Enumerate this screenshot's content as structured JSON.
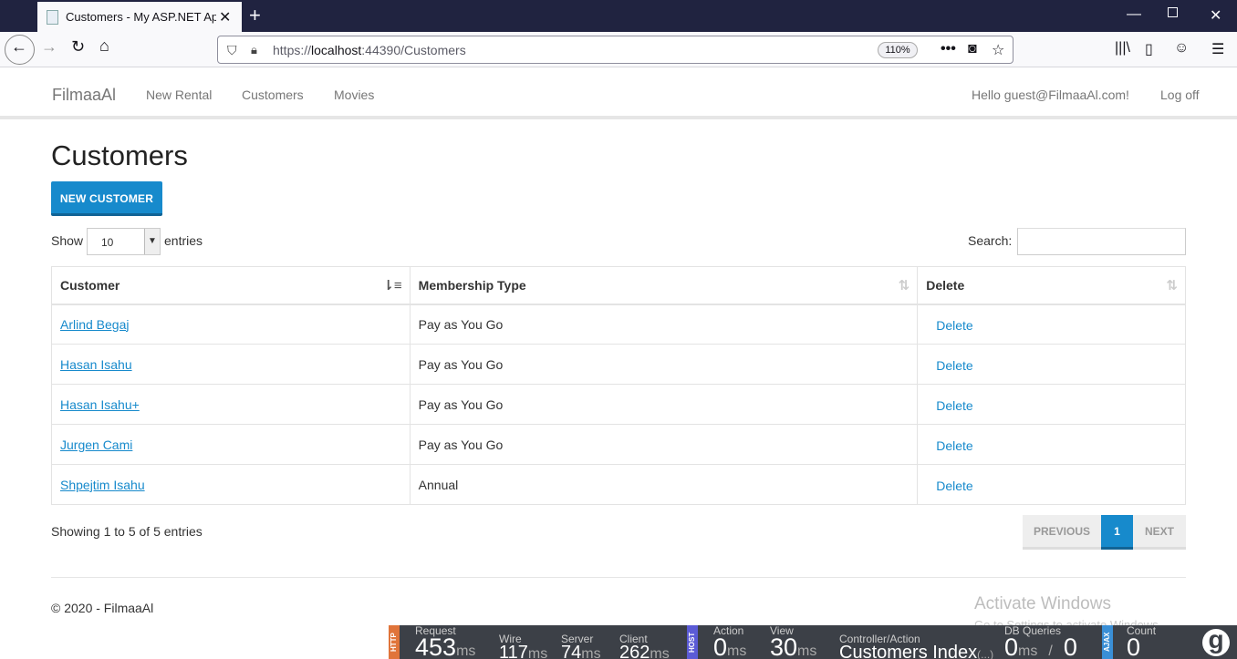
{
  "browser": {
    "tab_title": "Customers - My ASP.NET Appli",
    "url_prefix": "https://",
    "url_host": "localhost",
    "url_rest": ":44390/Customers",
    "zoom": "110%"
  },
  "navbar": {
    "brand": "FilmaaAl",
    "links": [
      "New Rental",
      "Customers",
      "Movies"
    ],
    "greeting": "Hello guest@FilmaaAl.com!",
    "logoff": "Log off"
  },
  "page": {
    "title": "Customers",
    "new_button": "NEW CUSTOMER",
    "show_label": "Show",
    "length_value": "10",
    "entries_label": "entries",
    "search_label": "Search:",
    "search_value": ""
  },
  "table": {
    "headers": [
      "Customer",
      "Membership Type",
      "Delete"
    ],
    "rows": [
      {
        "customer": "Arlind Begaj",
        "membership": "Pay as You Go",
        "action": "Delete"
      },
      {
        "customer": "Hasan Isahu",
        "membership": "Pay as You Go",
        "action": "Delete"
      },
      {
        "customer": "Hasan Isahu+",
        "membership": "Pay as You Go",
        "action": "Delete"
      },
      {
        "customer": "Jurgen Cami",
        "membership": "Pay as You Go",
        "action": "Delete"
      },
      {
        "customer": "Shpejtim Isahu",
        "membership": "Annual",
        "action": "Delete"
      }
    ]
  },
  "info": "Showing 1 to 5 of 5 entries",
  "pagination": {
    "previous": "PREVIOUS",
    "current": "1",
    "next": "NEXT"
  },
  "footer": "© 2020 - FilmaaAl",
  "watermark": {
    "line1": "Activate Windows",
    "line2": "Go to Settings to activate Windows."
  },
  "glimpse": {
    "http_tag": "HTTP",
    "host_tag": "HOST",
    "ajax_tag": "AJAX",
    "request": {
      "label": "Request",
      "value": "453",
      "unit": "ms"
    },
    "wire": {
      "label": "Wire",
      "value": "117",
      "unit": "ms"
    },
    "server": {
      "label": "Server",
      "value": "74",
      "unit": "ms"
    },
    "client": {
      "label": "Client",
      "value": "262",
      "unit": "ms"
    },
    "action": {
      "label": "Action",
      "value": "0",
      "unit": "ms"
    },
    "view": {
      "label": "View",
      "value": "30",
      "unit": "ms"
    },
    "controller": {
      "label": "Controller/Action",
      "value": "Customers Index",
      "suffix": "(...)"
    },
    "db": {
      "label": "DB Queries",
      "value": "0",
      "unit": "ms",
      "count": "0"
    },
    "count": {
      "label": "Count",
      "value": "0"
    },
    "logo": "g"
  },
  "colors": {
    "accent": "#178acc",
    "titlebar": "#202340",
    "glimpse": "#3c4047"
  }
}
